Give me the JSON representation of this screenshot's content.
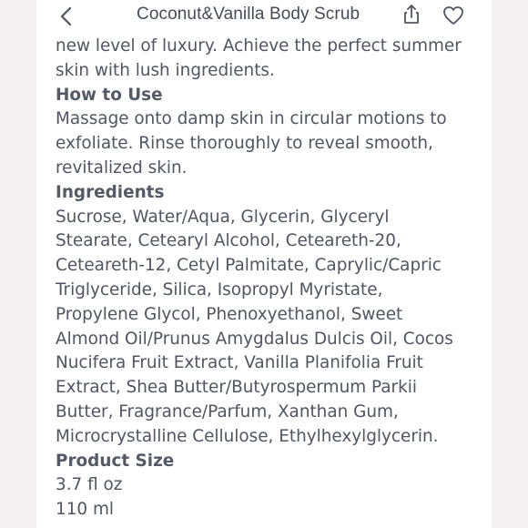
{
  "header": {
    "title": "Coconut&Vanilla Body Scrub",
    "back_icon": "chevron-left-icon",
    "share_icon": "share-icon",
    "like_icon": "heart-icon"
  },
  "content": {
    "intro_lines": [
      "new level of luxury. Achieve the perfect summer",
      "skin with lush ingredients."
    ],
    "how_to_use": {
      "heading": "How to Use",
      "lines": [
        "Massage onto damp skin in circular motions to",
        "exfoliate. Rinse thoroughly to reveal smooth,",
        "revitalized skin."
      ]
    },
    "ingredients": {
      "heading": "Ingredients",
      "lines": [
        "Sucrose, Water/Aqua, Glycerin, Glyceryl",
        "Stearate, Cetearyl Alcohol, Ceteareth-20,",
        "Ceteareth-12, Cetyl Palmitate, Caprylic/Capric",
        "Triglyceride, Silica, Isopropyl Myristate,",
        "Propylene Glycol, Phenoxyethanol, Sweet",
        "Almond Oil/Prunus Amygdalus Dulcis Oil, Cocos",
        "Nucifera Fruit Extract, Vanilla Planifolia Fruit",
        "Extract, Shea Butter/Butyrospermum Parkii",
        "Butter, Fragrance/Parfum, Xanthan Gum,",
        "Microcrystalline Cellulose, Ethylhexylglycerin."
      ]
    },
    "product_size": {
      "heading": "Product Size",
      "lines": [
        "3.7 fl oz",
        "110 ml"
      ]
    }
  }
}
